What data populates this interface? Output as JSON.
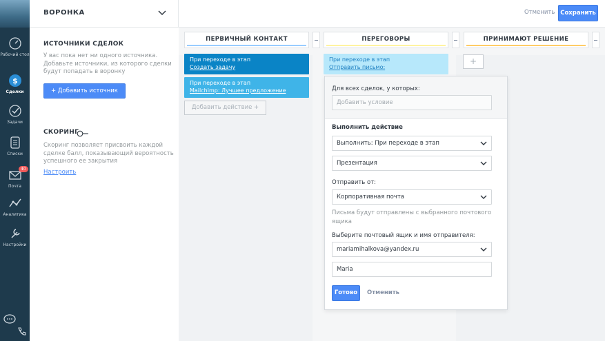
{
  "nav": {
    "items": [
      {
        "label": "Рабочий стол",
        "icon": "dashboard-icon"
      },
      {
        "label": "Сделки",
        "icon": "deals-icon",
        "active": true
      },
      {
        "label": "Задачи",
        "icon": "tasks-icon"
      },
      {
        "label": "Списки",
        "icon": "lists-icon"
      },
      {
        "label": "Почта",
        "icon": "mail-icon",
        "badge": "40"
      },
      {
        "label": "Аналитика",
        "icon": "analytics-icon"
      },
      {
        "label": "Настройки",
        "icon": "settings-icon"
      }
    ]
  },
  "topbar": {
    "funnel_title": "ВОРОНКА",
    "cancel_label": "Отменить",
    "save_label": "Сохранить"
  },
  "left_panel": {
    "sources_title": "ИСТОЧНИКИ СДЕЛОК",
    "sources_text": "У вас пока нет ни одного источника. Добавьте источники, из которого сделки будут попадать в воронку",
    "add_source_label": "+ Добавить источник",
    "scoring_title": "СКОРИНГ",
    "scoring_text": "Скоринг позволяет присвоить каждой сделке балл, показывающий вероятность успешного ее закрытия",
    "configure_label": "Настроить"
  },
  "columns": [
    {
      "title": "ПЕРВИЧНЫЙ КОНТАКТ",
      "line_color": "#99ccff"
    },
    {
      "title": "ПЕРЕГОВОРЫ",
      "line_color": "#fff3a0"
    },
    {
      "title": "ПРИНИМАЮТ РЕШЕНИЕ",
      "line_color": "#ffcc66"
    }
  ],
  "col1": {
    "trigger1": {
      "line1": "При переходе в этап",
      "line2": "Создать задачу"
    },
    "trigger2": {
      "line1": "При переходе в этап",
      "line2": "Mailchimp: Лучшее предложение"
    },
    "add_action_label": "Добавить действие  +"
  },
  "col2": {
    "trigger1": {
      "line1": "При переходе в этап",
      "line2": "Отправить письмо:"
    }
  },
  "col3": {
    "add_label": "+"
  },
  "popup": {
    "condition_label": "Для всех сделок, у которых:",
    "condition_placeholder": "Добавить условие",
    "action_title": "Выполнить действие",
    "execute_value": "Выполнить: При переходе в этап",
    "stage_value": "Презентация",
    "send_from_label": "Отправить от:",
    "send_from_value": "Корпоративная почта",
    "send_hint": "Письма будут отправлены с выбранного почтового ящика",
    "mailbox_label": "Выберите почтовый ящик и имя отправителя:",
    "mailbox_value": "mariamihalkova@yandex.ru",
    "sender_name": "Maria",
    "done_label": "Готово",
    "cancel_label": "Отменить"
  },
  "colors": {
    "accent": "#4c8bf7",
    "trigger_dark": "#0a84c6",
    "trigger_light": "#3fb4e8",
    "trigger_pale": "#b7e8fb"
  }
}
